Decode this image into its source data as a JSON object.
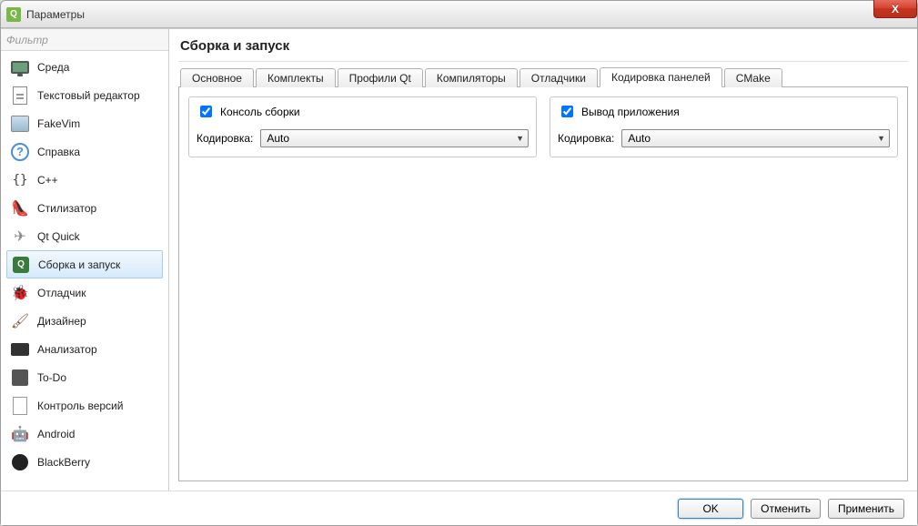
{
  "window": {
    "title": "Параметры",
    "close_glyph": "X"
  },
  "filter": {
    "placeholder": "Фильтр"
  },
  "sidebar": {
    "items": [
      {
        "label": "Среда"
      },
      {
        "label": "Текстовый редактор"
      },
      {
        "label": "FakeVim"
      },
      {
        "label": "Справка"
      },
      {
        "label": "C++"
      },
      {
        "label": "Стилизатор"
      },
      {
        "label": "Qt Quick"
      },
      {
        "label": "Сборка и запуск"
      },
      {
        "label": "Отладчик"
      },
      {
        "label": "Дизайнер"
      },
      {
        "label": "Анализатор"
      },
      {
        "label": "To-Do"
      },
      {
        "label": "Контроль версий"
      },
      {
        "label": "Android"
      },
      {
        "label": "BlackBerry"
      }
    ],
    "selected_index": 7
  },
  "page": {
    "title": "Сборка и запуск"
  },
  "tabs": {
    "items": [
      {
        "label": "Основное"
      },
      {
        "label": "Комплекты"
      },
      {
        "label": "Профили Qt"
      },
      {
        "label": "Компиляторы"
      },
      {
        "label": "Отладчики"
      },
      {
        "label": "Кодировка панелей"
      },
      {
        "label": "CMake"
      }
    ],
    "active_index": 5
  },
  "panel": {
    "left": {
      "checkbox_label": "Консоль сборки",
      "checked": true,
      "encoding_label": "Кодировка:",
      "encoding_value": "Auto"
    },
    "right": {
      "checkbox_label": "Вывод приложения",
      "checked": true,
      "encoding_label": "Кодировка:",
      "encoding_value": "Auto"
    }
  },
  "buttons": {
    "ok": "OK",
    "cancel": "Отменить",
    "apply": "Применить"
  }
}
